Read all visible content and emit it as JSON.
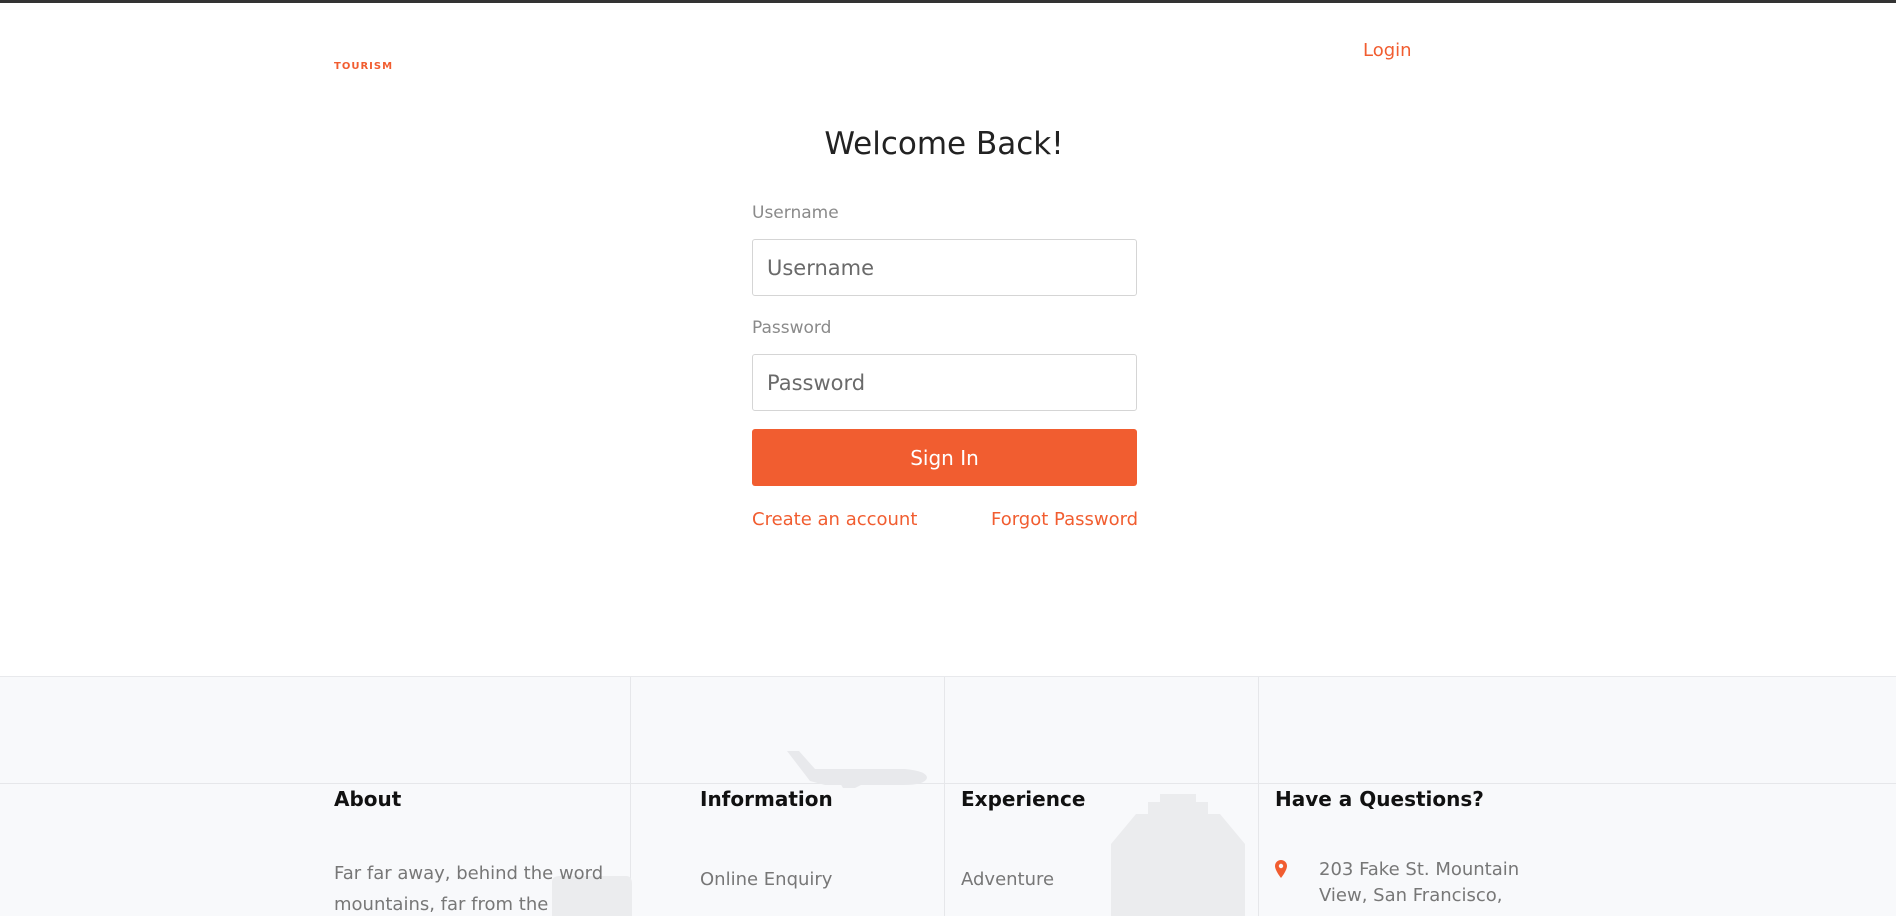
{
  "header": {
    "brand": "TOURISM",
    "login_link": "Login"
  },
  "form": {
    "title": "Welcome Back!",
    "username_label": "Username",
    "username_placeholder": "Username",
    "password_label": "Password",
    "password_placeholder": "Password",
    "submit_label": "Sign In",
    "create_account_link": "Create an account",
    "forgot_password_link": "Forgot Password"
  },
  "footer": {
    "about": {
      "title": "About",
      "text_line1": "Far far away, behind the word",
      "text_line2": "mountains, far from the"
    },
    "information": {
      "title": "Information",
      "items": [
        "Online Enquiry"
      ]
    },
    "experience": {
      "title": "Experience",
      "items": [
        "Adventure"
      ]
    },
    "questions": {
      "title": "Have a Questions?",
      "address_line1": "203 Fake St. Mountain",
      "address_line2": "View, San Francisco,"
    }
  },
  "colors": {
    "accent": "#f15d30",
    "footer_bg": "#f8f9fb"
  },
  "icons": {
    "address": "map-marker-icon",
    "decor_plane": "airplane-icon",
    "decor_building": "building-icon"
  }
}
